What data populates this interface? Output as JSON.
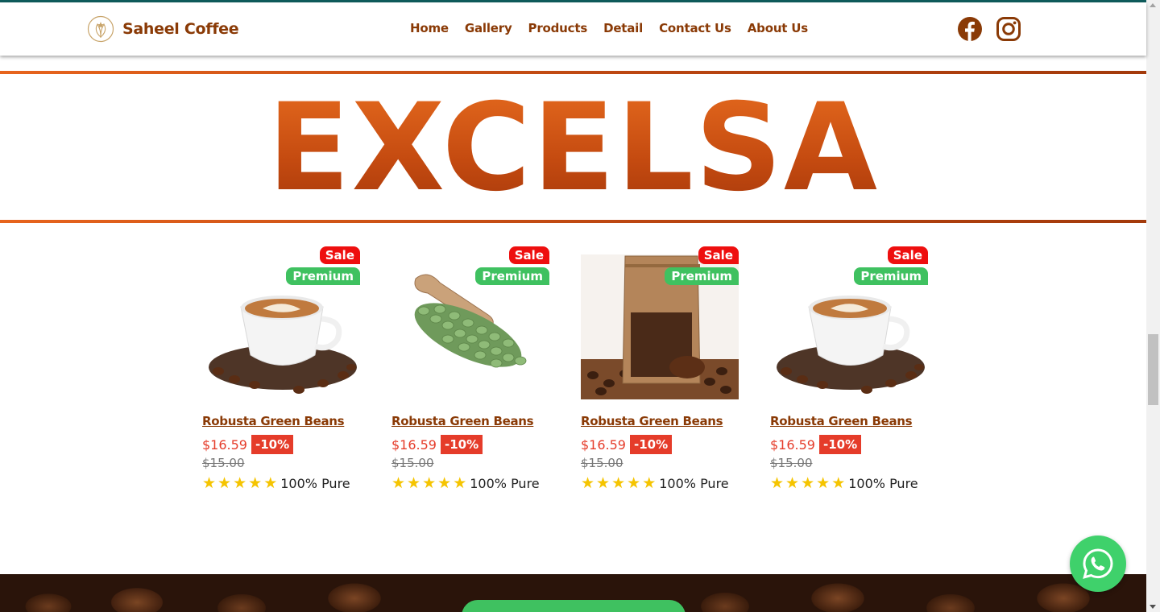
{
  "brand": {
    "name": "Saheel Coffee",
    "logo_icon": "coffee-leaf-logo"
  },
  "nav": {
    "items": [
      {
        "label": "Home"
      },
      {
        "label": "Gallery"
      },
      {
        "label": "Products"
      },
      {
        "label": "Detail"
      },
      {
        "label": "Contact Us"
      },
      {
        "label": "About Us"
      }
    ]
  },
  "social": {
    "facebook_icon": "facebook-icon",
    "instagram_icon": "instagram-icon"
  },
  "section": {
    "title": "EXCELSA"
  },
  "products": [
    {
      "image": "cup-with-beans",
      "sale_badge": "Sale",
      "premium_badge": "Premium",
      "name": "Robusta Green Beans",
      "price": "$16.59",
      "discount": "-10%",
      "old_price": "$15.00",
      "rating": 5,
      "tagline": "100% Pure"
    },
    {
      "image": "green-beans-scoop",
      "sale_badge": "Sale",
      "premium_badge": "Premium",
      "name": "Robusta Green Beans",
      "price": "$16.59",
      "discount": "-10%",
      "old_price": "$15.00",
      "rating": 5,
      "tagline": "100% Pure"
    },
    {
      "image": "coffee-pouch",
      "sale_badge": "Sale",
      "premium_badge": "Premium",
      "name": "Robusta Green Beans",
      "price": "$16.59",
      "discount": "-10%",
      "old_price": "$15.00",
      "rating": 5,
      "tagline": "100% Pure"
    },
    {
      "image": "cup-with-beans",
      "sale_badge": "Sale",
      "premium_badge": "Premium",
      "name": "Robusta Green Beans",
      "price": "$16.59",
      "discount": "-10%",
      "old_price": "$15.00",
      "rating": 5,
      "tagline": "100% Pure"
    }
  ],
  "floating": {
    "whatsapp_icon": "whatsapp-icon"
  },
  "colors": {
    "brand_brown": "#8a3a06",
    "accent_orange": "#c94f12",
    "sale_red": "#ee0f0f",
    "premium_green": "#3fc160",
    "price_red": "#e53c2a",
    "star_yellow": "#f5c400"
  }
}
